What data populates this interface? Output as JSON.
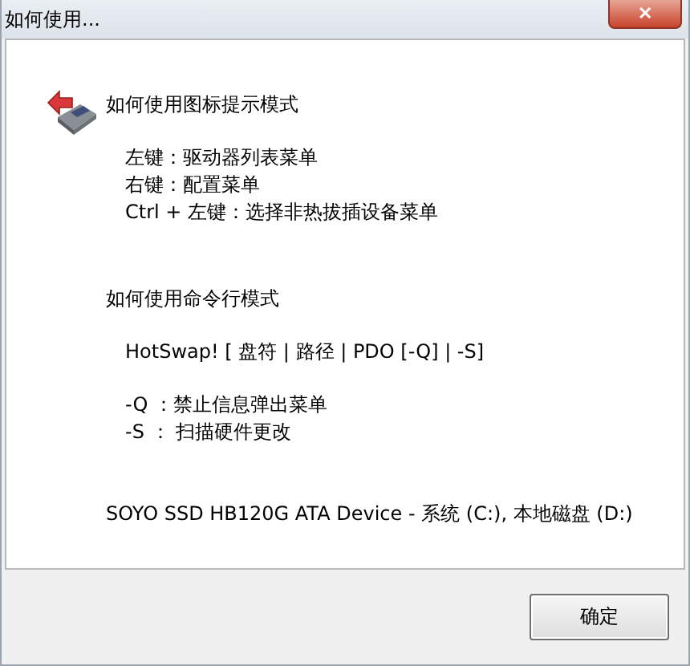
{
  "window": {
    "title": "如何使用...",
    "close": "✕"
  },
  "sections": [
    {
      "heading": "如何使用图标提示模式",
      "lines": [
        "左键：驱动器列表菜单",
        "右键：配置菜单",
        "Ctrl + 左键：选择非热拔插设备菜单"
      ]
    },
    {
      "heading": "如何使用命令行模式",
      "lines": [
        "HotSwap! [ 盘符 | 路径 | PDO [-Q] | -S]"
      ]
    },
    {
      "lines": [
        "-Q ：禁止信息弹出菜单",
        "-S ： 扫描硬件更改"
      ]
    }
  ],
  "device": "SOYO SSD HB120G ATA Device - 系统 (C:), 本地磁盘 (D:)",
  "buttons": [
    "确定"
  ]
}
